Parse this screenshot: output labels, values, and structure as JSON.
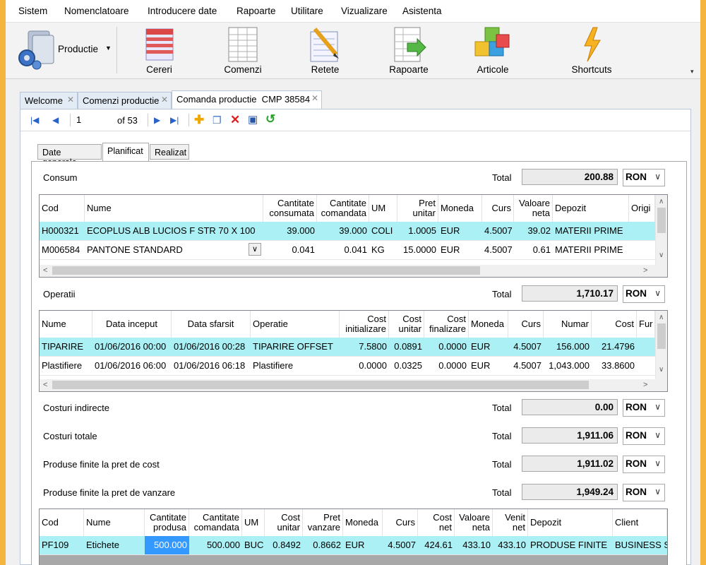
{
  "menu": [
    "Sistem",
    "Nomenclatoare",
    "Introducere date",
    "Rapoarte",
    "Utilitare",
    "Vizualizare",
    "Asistenta"
  ],
  "ribbon": {
    "productie": "Productie",
    "items": [
      "Cereri",
      "Comenzi",
      "Retete",
      "Rapoarte",
      "Articole",
      "Shortcuts"
    ]
  },
  "tabs": [
    "Welcome",
    "Comenzi productie",
    "Comanda productie  CMP 38584"
  ],
  "nav": {
    "record": "1",
    "of": "of 53"
  },
  "subtabs": [
    "Date generale",
    "Planificat",
    "Realizat"
  ],
  "consum": {
    "label": "Consum",
    "total_label": "Total",
    "total": "200.88",
    "currency": "RON",
    "headers": [
      "Cod",
      "Nume",
      "Cantitate\nconsumata",
      "Cantitate\ncomandata",
      "UM",
      "Pret\nunitar",
      "Moneda",
      "Curs",
      "Valoare\nneta",
      "Depozit",
      "Origi"
    ],
    "rows": [
      [
        "H000321",
        "ECOPLUS ALB LUCIOS F STR 70 X 100",
        "39.000",
        "39.000",
        "COLI",
        "1.0005",
        "EUR",
        "4.5007",
        "39.02",
        "MATERII PRIME",
        ""
      ],
      [
        "M006584",
        "PANTONE STANDARD",
        "0.041",
        "0.041",
        "KG",
        "15.0000",
        "EUR",
        "4.5007",
        "0.61",
        "MATERII PRIME",
        ""
      ]
    ]
  },
  "operatii": {
    "label": "Operatii",
    "total_label": "Total",
    "total": "1,710.17",
    "currency": "RON",
    "headers": [
      "Nume",
      "Data inceput",
      "Data sfarsit",
      "Operatie",
      "Cost\ninitializare",
      "Cost\nunitar",
      "Cost\nfinalizare",
      "Moneda",
      "Curs",
      "Numar",
      "Cost",
      "Fur"
    ],
    "rows": [
      [
        "TIPARIRE",
        "01/06/2016 00:00",
        "01/06/2016 00:28",
        "TIPARIRE OFFSET",
        "7.5800",
        "0.0891",
        "0.0000",
        "EUR",
        "4.5007",
        "156.000",
        "21.4796",
        ""
      ],
      [
        "Plastifiere",
        "01/06/2016 06:00",
        "01/06/2016 06:18",
        "Plastifiere",
        "0.0000",
        "0.0325",
        "0.0000",
        "EUR",
        "4.5007",
        "1,043.000",
        "33.8600",
        ""
      ]
    ]
  },
  "summary": [
    {
      "label": "Costuri indirecte",
      "total_label": "Total",
      "value": "0.00",
      "currency": "RON"
    },
    {
      "label": "Costuri totale",
      "total_label": "Total",
      "value": "1,911.06",
      "currency": "RON"
    },
    {
      "label": "Produse finite la pret de cost",
      "total_label": "Total",
      "value": "1,911.02",
      "currency": "RON"
    },
    {
      "label": "Produse finite la pret de vanzare",
      "total_label": "Total",
      "value": "1,949.24",
      "currency": "RON"
    }
  ],
  "produse": {
    "headers": [
      "Cod",
      "Nume",
      "Cantitate\nprodusa",
      "Cantitate\ncomandata",
      "UM",
      "Cost\nunitar",
      "Pret\nvanzare",
      "Moneda",
      "Curs",
      "Cost\nnet",
      "Valoare\nneta",
      "Venit\nnet",
      "Depozit",
      "Client"
    ],
    "rows": [
      [
        "PF109",
        "Etichete",
        "500.000",
        "500.000",
        "BUC",
        "0.8492",
        "0.8662",
        "EUR",
        "4.5007",
        "424.61",
        "433.10",
        "433.10",
        "PRODUSE FINITE",
        "BUSINESS S"
      ]
    ]
  },
  "colors": {
    "accent": "#f5b43d",
    "selected_row": "#aaf0f4",
    "selected_cell": "#3399ff"
  }
}
